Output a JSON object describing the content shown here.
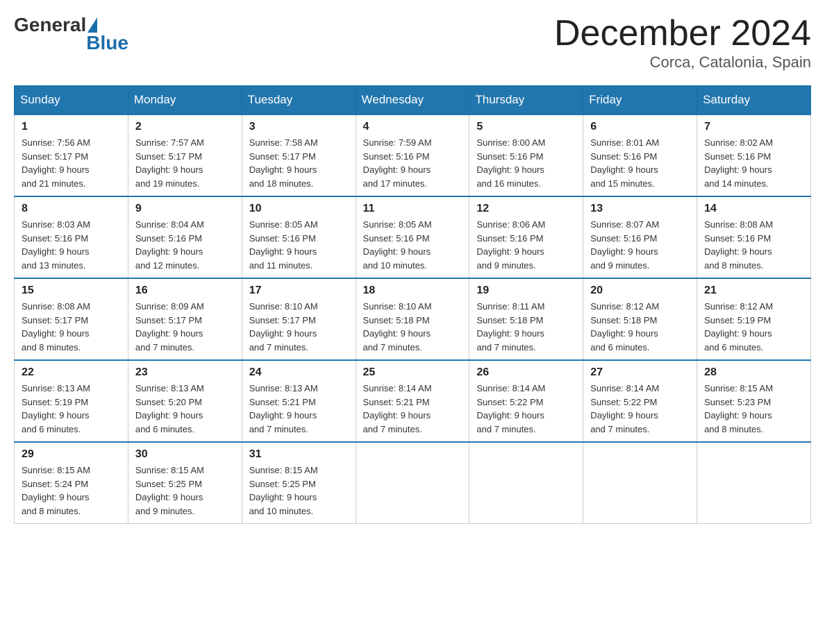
{
  "header": {
    "logo": {
      "general": "General",
      "blue": "Blue"
    },
    "title": "December 2024",
    "location": "Corca, Catalonia, Spain"
  },
  "days_of_week": [
    "Sunday",
    "Monday",
    "Tuesday",
    "Wednesday",
    "Thursday",
    "Friday",
    "Saturday"
  ],
  "weeks": [
    [
      {
        "day": "1",
        "sunrise": "7:56 AM",
        "sunset": "5:17 PM",
        "daylight": "9 hours and 21 minutes."
      },
      {
        "day": "2",
        "sunrise": "7:57 AM",
        "sunset": "5:17 PM",
        "daylight": "9 hours and 19 minutes."
      },
      {
        "day": "3",
        "sunrise": "7:58 AM",
        "sunset": "5:17 PM",
        "daylight": "9 hours and 18 minutes."
      },
      {
        "day": "4",
        "sunrise": "7:59 AM",
        "sunset": "5:16 PM",
        "daylight": "9 hours and 17 minutes."
      },
      {
        "day": "5",
        "sunrise": "8:00 AM",
        "sunset": "5:16 PM",
        "daylight": "9 hours and 16 minutes."
      },
      {
        "day": "6",
        "sunrise": "8:01 AM",
        "sunset": "5:16 PM",
        "daylight": "9 hours and 15 minutes."
      },
      {
        "day": "7",
        "sunrise": "8:02 AM",
        "sunset": "5:16 PM",
        "daylight": "9 hours and 14 minutes."
      }
    ],
    [
      {
        "day": "8",
        "sunrise": "8:03 AM",
        "sunset": "5:16 PM",
        "daylight": "9 hours and 13 minutes."
      },
      {
        "day": "9",
        "sunrise": "8:04 AM",
        "sunset": "5:16 PM",
        "daylight": "9 hours and 12 minutes."
      },
      {
        "day": "10",
        "sunrise": "8:05 AM",
        "sunset": "5:16 PM",
        "daylight": "9 hours and 11 minutes."
      },
      {
        "day": "11",
        "sunrise": "8:05 AM",
        "sunset": "5:16 PM",
        "daylight": "9 hours and 10 minutes."
      },
      {
        "day": "12",
        "sunrise": "8:06 AM",
        "sunset": "5:16 PM",
        "daylight": "9 hours and 9 minutes."
      },
      {
        "day": "13",
        "sunrise": "8:07 AM",
        "sunset": "5:16 PM",
        "daylight": "9 hours and 9 minutes."
      },
      {
        "day": "14",
        "sunrise": "8:08 AM",
        "sunset": "5:16 PM",
        "daylight": "9 hours and 8 minutes."
      }
    ],
    [
      {
        "day": "15",
        "sunrise": "8:08 AM",
        "sunset": "5:17 PM",
        "daylight": "9 hours and 8 minutes."
      },
      {
        "day": "16",
        "sunrise": "8:09 AM",
        "sunset": "5:17 PM",
        "daylight": "9 hours and 7 minutes."
      },
      {
        "day": "17",
        "sunrise": "8:10 AM",
        "sunset": "5:17 PM",
        "daylight": "9 hours and 7 minutes."
      },
      {
        "day": "18",
        "sunrise": "8:10 AM",
        "sunset": "5:18 PM",
        "daylight": "9 hours and 7 minutes."
      },
      {
        "day": "19",
        "sunrise": "8:11 AM",
        "sunset": "5:18 PM",
        "daylight": "9 hours and 7 minutes."
      },
      {
        "day": "20",
        "sunrise": "8:12 AM",
        "sunset": "5:18 PM",
        "daylight": "9 hours and 6 minutes."
      },
      {
        "day": "21",
        "sunrise": "8:12 AM",
        "sunset": "5:19 PM",
        "daylight": "9 hours and 6 minutes."
      }
    ],
    [
      {
        "day": "22",
        "sunrise": "8:13 AM",
        "sunset": "5:19 PM",
        "daylight": "9 hours and 6 minutes."
      },
      {
        "day": "23",
        "sunrise": "8:13 AM",
        "sunset": "5:20 PM",
        "daylight": "9 hours and 6 minutes."
      },
      {
        "day": "24",
        "sunrise": "8:13 AM",
        "sunset": "5:21 PM",
        "daylight": "9 hours and 7 minutes."
      },
      {
        "day": "25",
        "sunrise": "8:14 AM",
        "sunset": "5:21 PM",
        "daylight": "9 hours and 7 minutes."
      },
      {
        "day": "26",
        "sunrise": "8:14 AM",
        "sunset": "5:22 PM",
        "daylight": "9 hours and 7 minutes."
      },
      {
        "day": "27",
        "sunrise": "8:14 AM",
        "sunset": "5:22 PM",
        "daylight": "9 hours and 7 minutes."
      },
      {
        "day": "28",
        "sunrise": "8:15 AM",
        "sunset": "5:23 PM",
        "daylight": "9 hours and 8 minutes."
      }
    ],
    [
      {
        "day": "29",
        "sunrise": "8:15 AM",
        "sunset": "5:24 PM",
        "daylight": "9 hours and 8 minutes."
      },
      {
        "day": "30",
        "sunrise": "8:15 AM",
        "sunset": "5:25 PM",
        "daylight": "9 hours and 9 minutes."
      },
      {
        "day": "31",
        "sunrise": "8:15 AM",
        "sunset": "5:25 PM",
        "daylight": "9 hours and 10 minutes."
      },
      null,
      null,
      null,
      null
    ]
  ],
  "labels": {
    "sunrise": "Sunrise:",
    "sunset": "Sunset:",
    "daylight": "Daylight:"
  },
  "accent_color": "#2176ae"
}
